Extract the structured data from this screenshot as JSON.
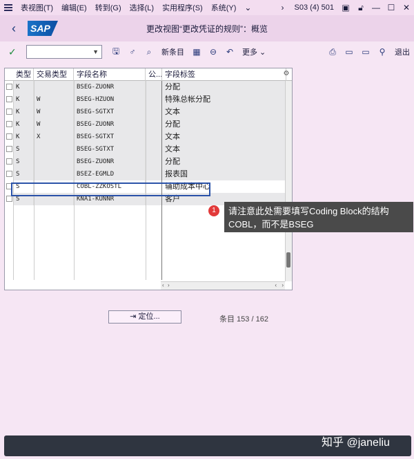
{
  "menu": {
    "items": [
      "表视图(T)",
      "编辑(E)",
      "转到(G)",
      "选择(L)",
      "实用程序(S)",
      "系统(Y)"
    ],
    "system_info": "S03 (4) 501"
  },
  "title": {
    "text": "更改视图“更改凭证的规则”：概览",
    "logo": "SAP"
  },
  "toolbar": {
    "new_entries": "新条目",
    "more": "更多",
    "exit": "退出"
  },
  "table": {
    "columns": [
      "类型",
      "交易类型",
      "字段名称",
      "公...",
      "字段标签"
    ],
    "rows": [
      {
        "type": "K",
        "trans": "",
        "field": "BSEG-ZUONR",
        "pub": "",
        "label": "分配"
      },
      {
        "type": "K",
        "trans": "W",
        "field": "BSEG-HZUON",
        "pub": "",
        "label": "特殊总帐分配"
      },
      {
        "type": "K",
        "trans": "W",
        "field": "BSEG-SGTXT",
        "pub": "",
        "label": "文本"
      },
      {
        "type": "K",
        "trans": "W",
        "field": "BSEG-ZUONR",
        "pub": "",
        "label": "分配"
      },
      {
        "type": "K",
        "trans": "X",
        "field": "BSEG-SGTXT",
        "pub": "",
        "label": "文本"
      },
      {
        "type": "S",
        "trans": "",
        "field": "BSEG-SGTXT",
        "pub": "",
        "label": "文本"
      },
      {
        "type": "S",
        "trans": "",
        "field": "BSEG-ZUONR",
        "pub": "",
        "label": "分配"
      },
      {
        "type": "S",
        "trans": "",
        "field": "BSEZ-EGMLD",
        "pub": "",
        "label": "报表国"
      },
      {
        "type": "S",
        "trans": "",
        "field": "COBL-ZZKOSTL",
        "pub": "",
        "label": "辅助成本中心"
      },
      {
        "type": "S",
        "trans": "",
        "field": "KNA1-KUNNR",
        "pub": "",
        "label": "客户"
      }
    ]
  },
  "callout": {
    "number": "1",
    "text": "请注意此处需要填写Coding Block的结构COBL，而不是BSEG"
  },
  "locate_button": "定位...",
  "entry_count": "条目 153 / 162",
  "watermark": "知乎 @janeliu",
  "colors": {
    "accent": "#2a52a8",
    "menu_bg": "#f3ddf0",
    "badge": "#e23a3a"
  }
}
